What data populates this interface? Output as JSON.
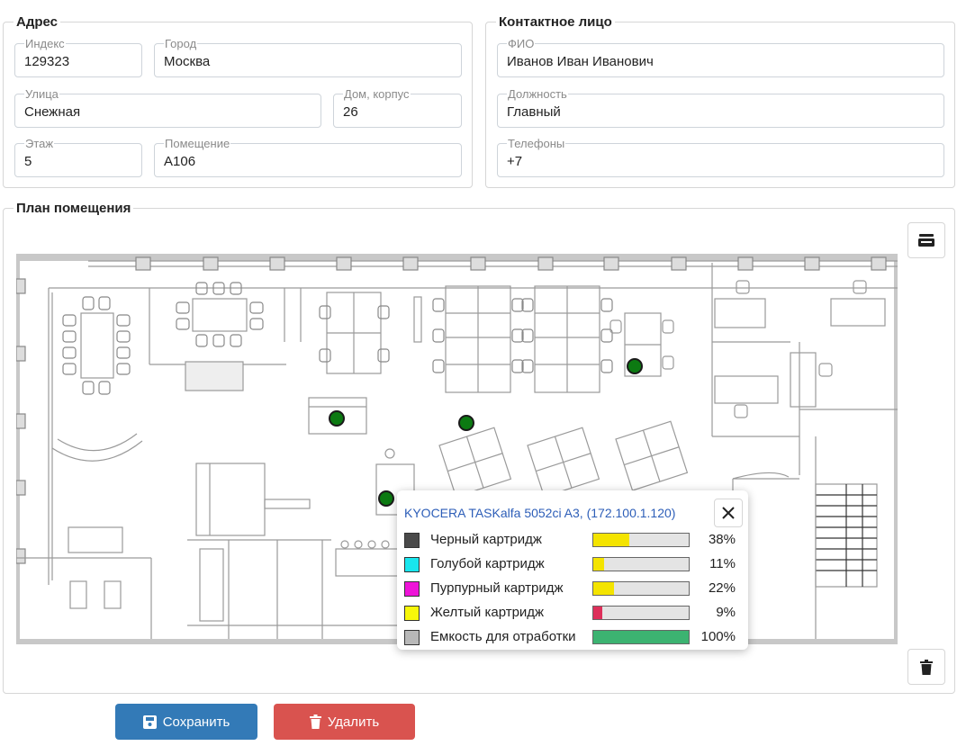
{
  "address": {
    "legend": "Адрес",
    "index": {
      "label": "Индекс",
      "value": "129323"
    },
    "city": {
      "label": "Город",
      "value": "Москва"
    },
    "street": {
      "label": "Улица",
      "value": "Снежная"
    },
    "house": {
      "label": "Дом, корпус",
      "value": "26"
    },
    "floor": {
      "label": "Этаж",
      "value": "5"
    },
    "room": {
      "label": "Помещение",
      "value": "A106"
    }
  },
  "contact": {
    "legend": "Контактное лицо",
    "name": {
      "label": "ФИО",
      "value": "Иванов Иван Иванович"
    },
    "position": {
      "label": "Должность",
      "value": "Главный"
    },
    "phones": {
      "label": "Телефоны",
      "value": "+7"
    }
  },
  "plan": {
    "legend": "План помещения",
    "scan_icon": "scanner-icon",
    "delete_icon": "trash-icon",
    "marker_color": "#0c7a12"
  },
  "popup": {
    "device": "KYOCERA TASKalfa 5052ci A3,",
    "ip": "(172.100.1.120)",
    "close_icon": "close-icon",
    "supplies": [
      {
        "label": "Черный картридж",
        "percent": "38%",
        "level": 38,
        "swatch": "#4a4a4a",
        "fill": "#f4e400"
      },
      {
        "label": "Голубой картридж",
        "percent": "11%",
        "level": 11,
        "swatch": "#19e6ee",
        "fill": "#f4e400"
      },
      {
        "label": "Пурпурный картридж",
        "percent": "22%",
        "level": 22,
        "swatch": "#ee14d8",
        "fill": "#f4e400"
      },
      {
        "label": "Желтый картридж",
        "percent": "9%",
        "level": 9,
        "swatch": "#f7f70a",
        "fill": "#dd2f5a"
      },
      {
        "label": "Емкость для отработки",
        "percent": "100%",
        "level": 100,
        "swatch": "#b8b8b8",
        "fill": "#3cb371"
      }
    ]
  },
  "actions": {
    "save_label": "Сохранить",
    "save_color": "#337ab7",
    "delete_label": "Удалить",
    "delete_color": "#d9534f"
  }
}
